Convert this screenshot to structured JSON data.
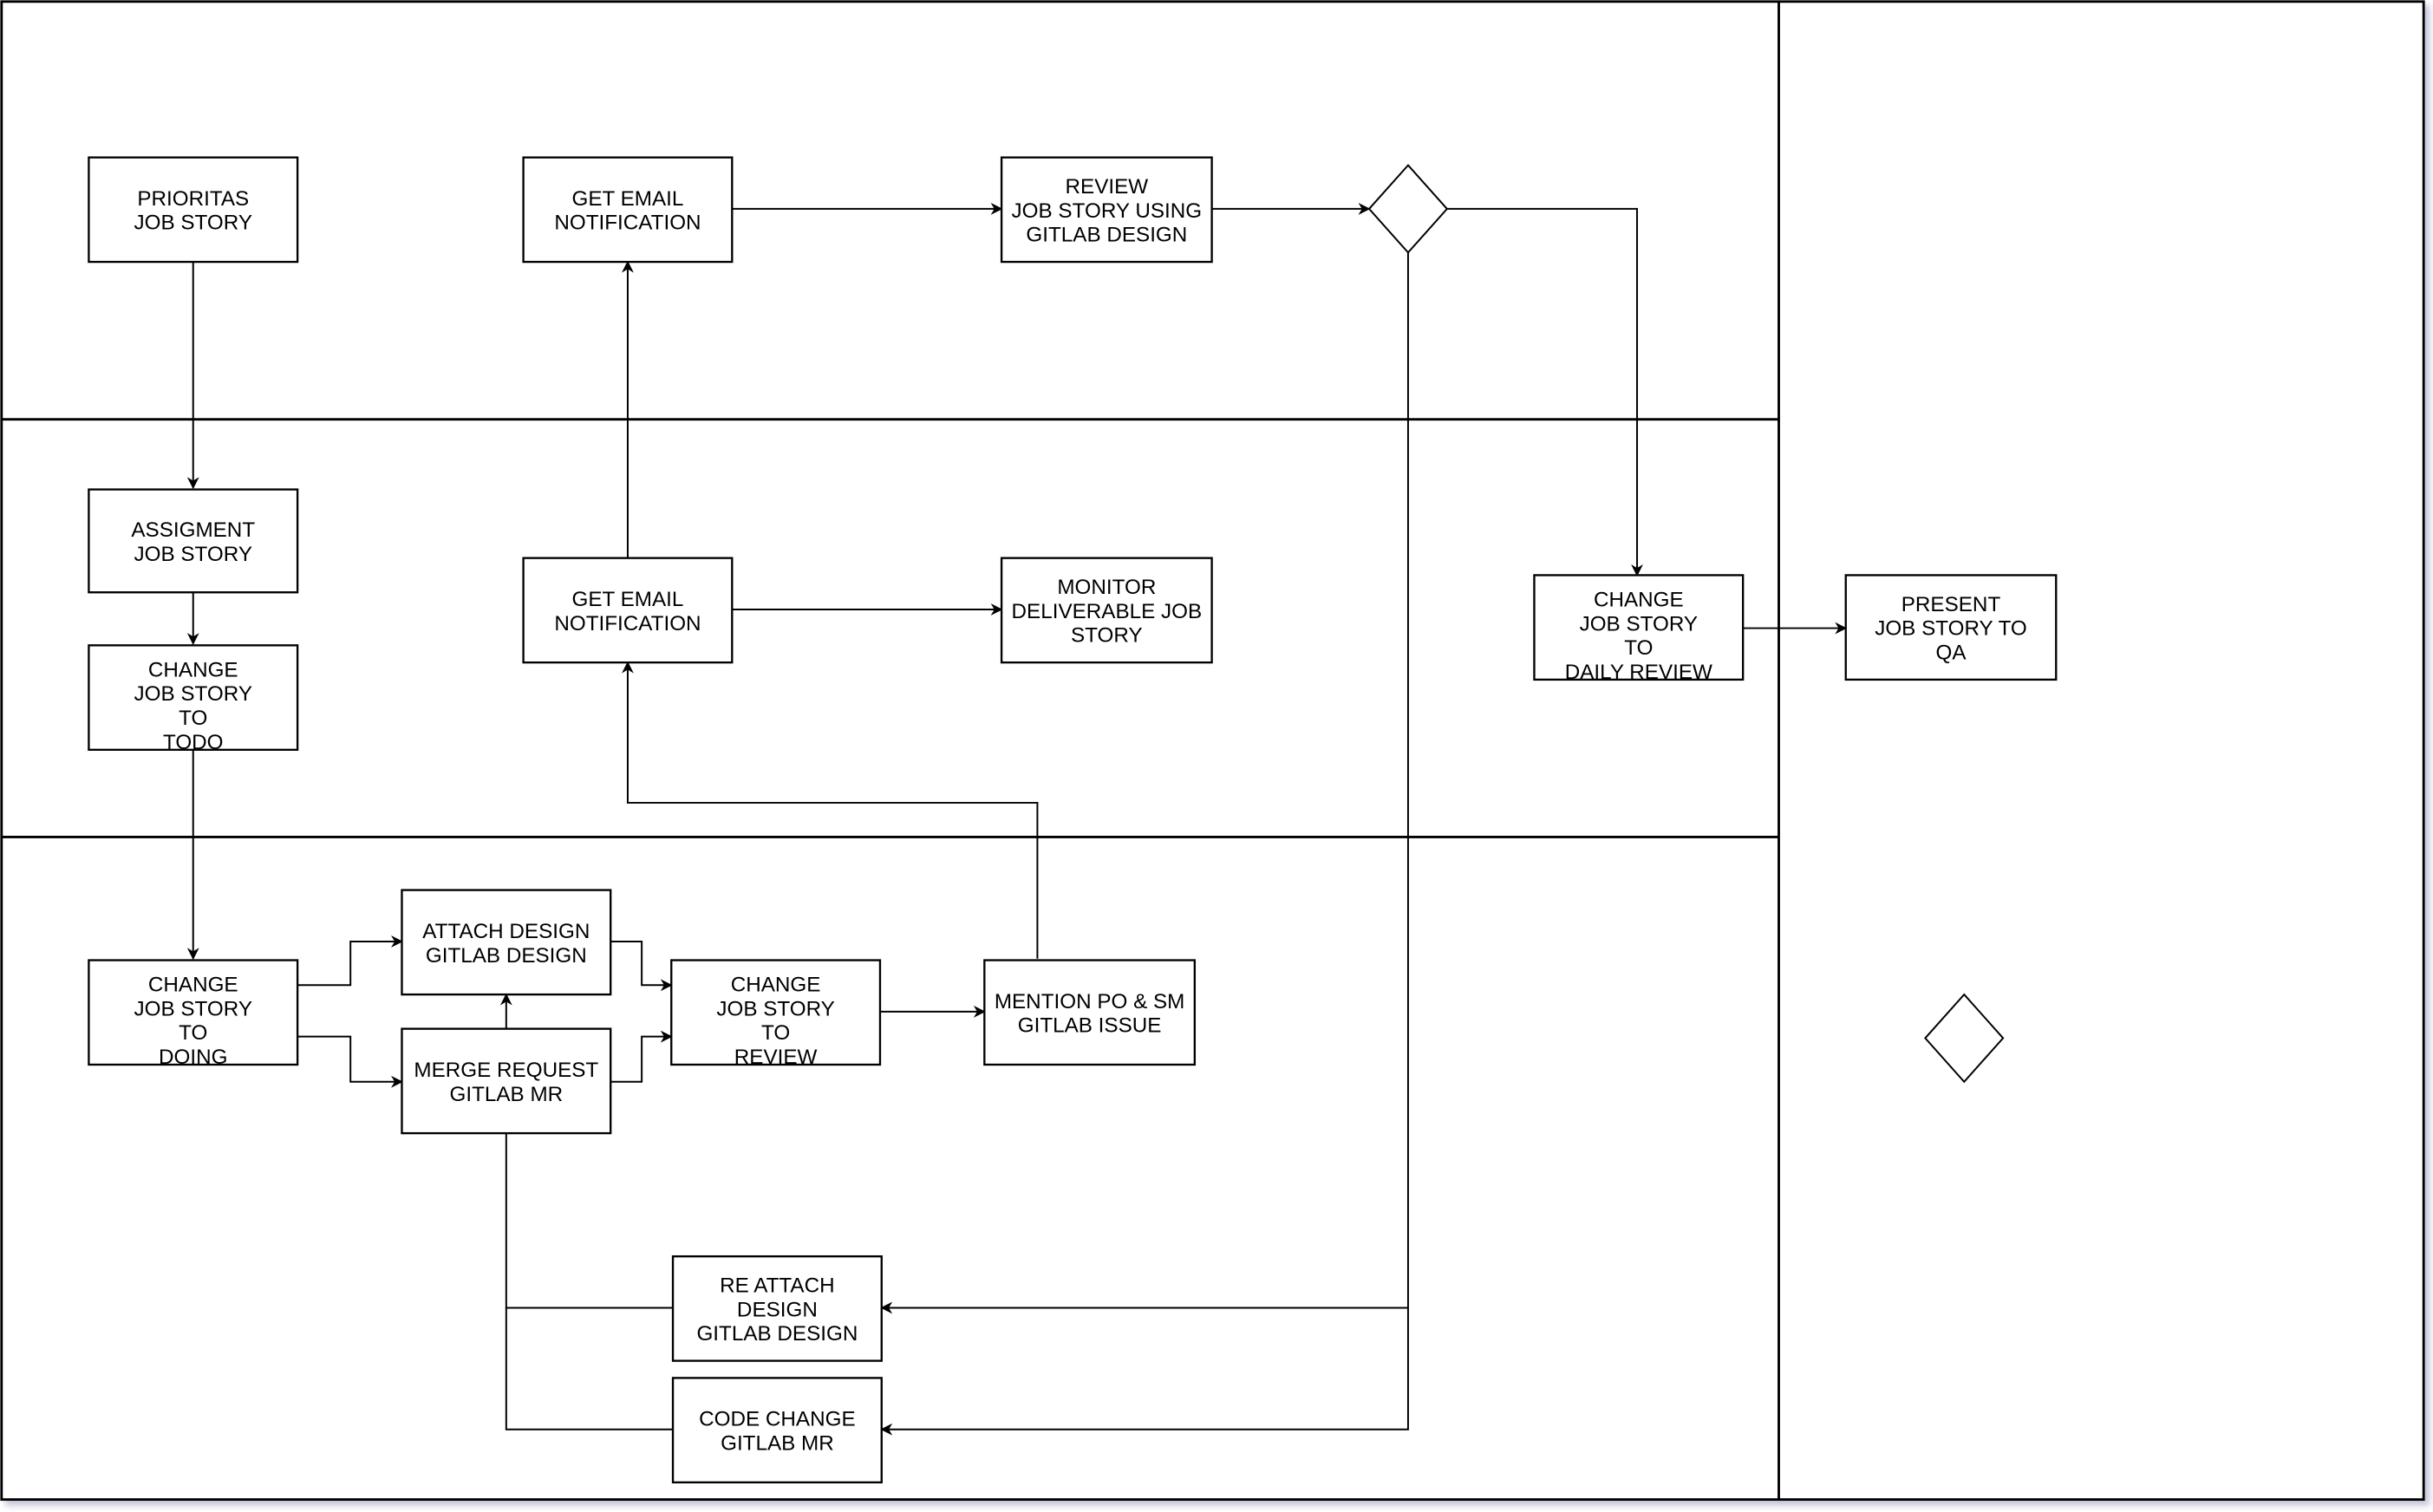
{
  "diagram": {
    "type": "swimlane-flowchart",
    "lanes": [
      "lane-1",
      "lane-2",
      "lane-3",
      "lane-right"
    ],
    "nodes": [
      {
        "id": "prioritas",
        "lines": [
          "PRIORITAS",
          "JOB STORY"
        ]
      },
      {
        "id": "email1",
        "lines": [
          "GET EMAIL",
          "NOTIFICATION"
        ]
      },
      {
        "id": "review",
        "lines": [
          "REVIEW",
          "JOB STORY USING",
          "GITLAB DESIGN"
        ]
      },
      {
        "id": "assign",
        "lines": [
          "ASSIGMENT",
          "JOB STORY"
        ]
      },
      {
        "id": "todo",
        "lines": [
          "CHANGE",
          "JOB STORY",
          "TO",
          "TODO"
        ]
      },
      {
        "id": "email2",
        "lines": [
          "GET EMAIL",
          "NOTIFICATION"
        ]
      },
      {
        "id": "monitor",
        "lines": [
          "MONITOR",
          "DELIVERABLE JOB",
          "STORY"
        ]
      },
      {
        "id": "daily",
        "lines": [
          "CHANGE",
          "JOB STORY",
          "TO",
          "DAILY REVIEW"
        ]
      },
      {
        "id": "qa",
        "lines": [
          "PRESENT",
          "JOB STORY TO",
          "QA"
        ]
      },
      {
        "id": "doing",
        "lines": [
          "CHANGE",
          "JOB STORY",
          "TO",
          "DOING"
        ]
      },
      {
        "id": "attach",
        "lines": [
          "ATTACH DESIGN",
          "GITLAB DESIGN"
        ]
      },
      {
        "id": "merge",
        "lines": [
          "MERGE REQUEST",
          "GITLAB MR"
        ]
      },
      {
        "id": "toreview",
        "lines": [
          "CHANGE",
          "JOB STORY",
          "TO",
          "REVIEW"
        ]
      },
      {
        "id": "mention",
        "lines": [
          "MENTION PO & SM",
          "GITLAB ISSUE"
        ]
      },
      {
        "id": "reattach",
        "lines": [
          "RE ATTACH",
          "DESIGN",
          "GITLAB DESIGN"
        ]
      },
      {
        "id": "codechange",
        "lines": [
          "CODE CHANGE",
          "GITLAB MR"
        ]
      }
    ],
    "decisions": [
      "review-decision",
      "unconnected-decision"
    ],
    "edges": [
      [
        "prioritas",
        "assign"
      ],
      [
        "assign",
        "todo"
      ],
      [
        "todo",
        "doing"
      ],
      [
        "doing",
        "attach"
      ],
      [
        "doing",
        "merge"
      ],
      [
        "attach",
        "toreview"
      ],
      [
        "merge",
        "toreview"
      ],
      [
        "toreview",
        "mention"
      ],
      [
        "mention",
        "email2"
      ],
      [
        "email2",
        "email1"
      ],
      [
        "email2",
        "monitor"
      ],
      [
        "email1",
        "review"
      ],
      [
        "review",
        "review-decision"
      ],
      [
        "review-decision",
        "daily"
      ],
      [
        "review-decision",
        "reattach"
      ],
      [
        "review-decision",
        "codechange"
      ],
      [
        "reattach",
        "attach"
      ],
      [
        "codechange",
        "attach"
      ],
      [
        "daily",
        "qa"
      ]
    ]
  }
}
